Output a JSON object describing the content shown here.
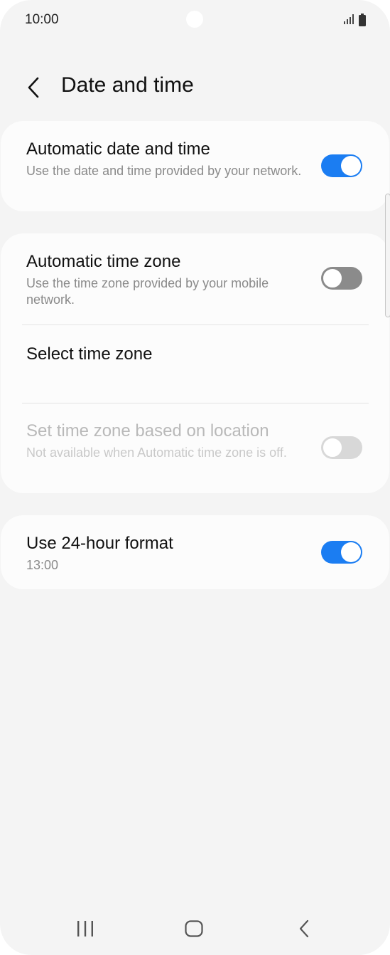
{
  "status_bar": {
    "time": "10:00"
  },
  "header": {
    "title": "Date and time"
  },
  "settings": {
    "auto_date_time": {
      "title": "Automatic date and time",
      "subtitle": "Use the date and time provided by your network.",
      "enabled": true
    },
    "auto_time_zone": {
      "title": "Automatic time zone",
      "subtitle": "Use the time zone provided by your mobile network.",
      "enabled": false
    },
    "select_time_zone": {
      "title": "Select time zone"
    },
    "location_time_zone": {
      "title": "Set time zone based on location",
      "subtitle": "Not available when Automatic time zone is off.",
      "enabled": false,
      "available": false
    },
    "format_24h": {
      "title": "Use 24-hour format",
      "subtitle": "13:00",
      "enabled": true
    }
  },
  "colors": {
    "accent": "#1b7df2",
    "background": "#f4f4f4",
    "card": "#fcfcfc",
    "toggle_off": "#8b8b8b",
    "toggle_disabled": "#d8d8d8"
  },
  "icons": [
    "back-arrow-icon",
    "signal-icon",
    "battery-icon",
    "recents-icon",
    "home-icon",
    "back-icon"
  ]
}
